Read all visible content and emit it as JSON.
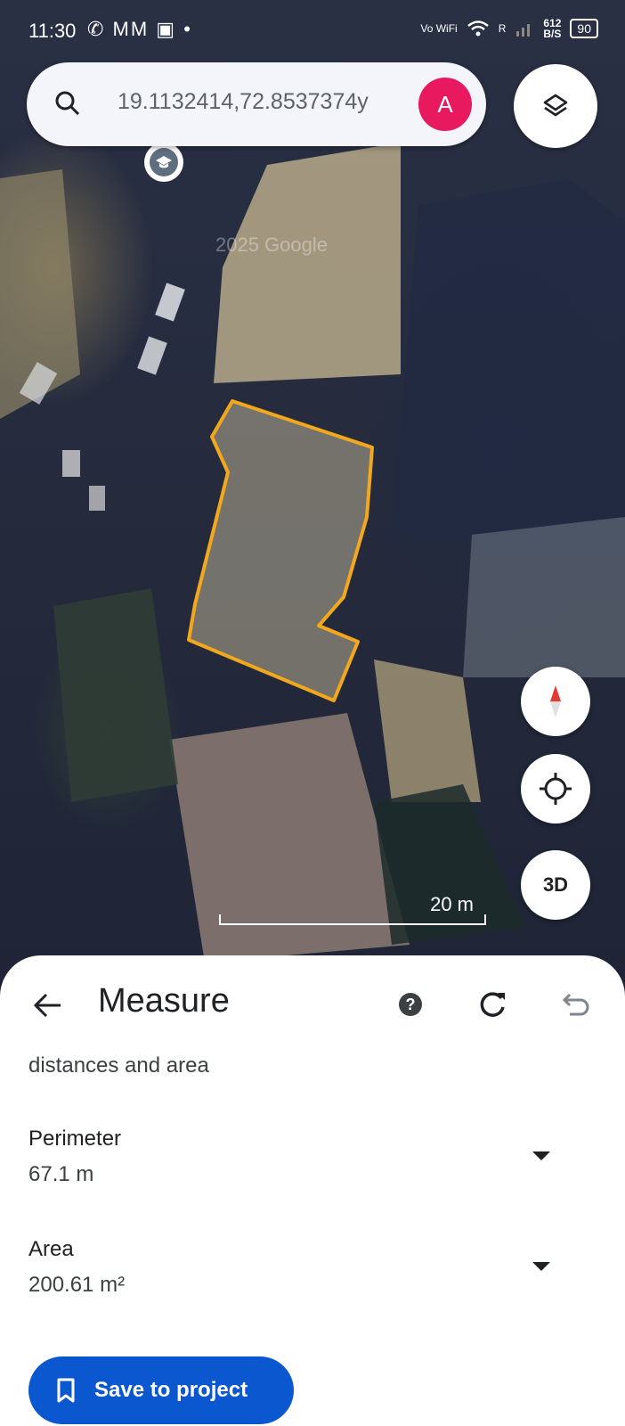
{
  "status_bar": {
    "time": "11:30",
    "left_icons": "✆ MM ▣  •",
    "network_label": "Vo WiFi",
    "speed_value": "612",
    "speed_unit": "B/S",
    "signal_label": "R",
    "battery": "90"
  },
  "search": {
    "query": "19.1132414,72.8537374y",
    "avatar_letter": "A"
  },
  "map": {
    "watermark": "2025 Google",
    "scale_label": "20 m",
    "button_3d_label": "3D",
    "outline_color": "#f2a81d"
  },
  "measure_panel": {
    "title": "Measure",
    "help_label": "?",
    "subtitle": "distances and area",
    "perimeter_label": "Perimeter",
    "perimeter_value": "67.1 m",
    "area_label": "Area",
    "area_value": "200.61 m²",
    "save_label": "Save to project"
  },
  "colors": {
    "accent": "#0b57d0",
    "avatar": "#e8195e"
  }
}
